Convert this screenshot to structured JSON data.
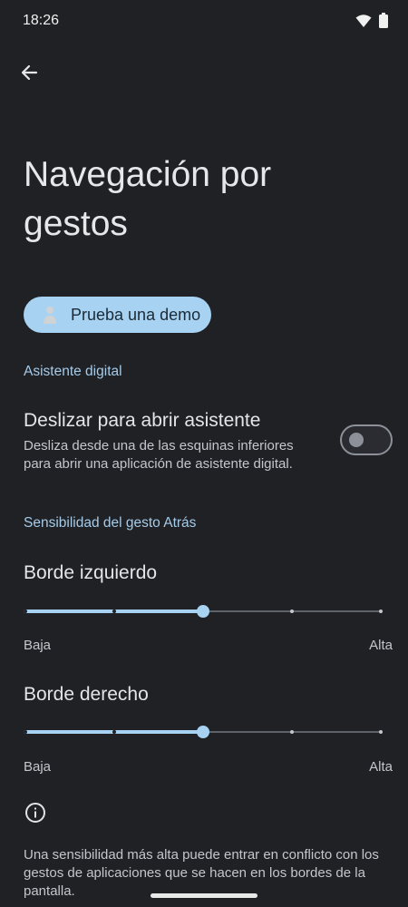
{
  "status_bar": {
    "time": "18:26",
    "icons": [
      "wifi-icon",
      "battery-icon"
    ]
  },
  "header": {
    "back_icon": "arrow-back-icon",
    "title": "Navegación por gestos"
  },
  "demo": {
    "label": "Prueba una demo",
    "icon": "person-figure-icon"
  },
  "assistant_section": {
    "header": "Asistente digital",
    "toggle_title": "Deslizar para abrir asistente",
    "toggle_summary": "Desliza desde una de las esquinas inferiores para abrir una aplicación de asistente digital.",
    "toggle_on": false
  },
  "sensitivity_section": {
    "header": "Sensibilidad del gesto Atrás",
    "sliders": [
      {
        "title": "Borde izquierdo",
        "min_label": "Baja",
        "max_label": "Alta",
        "value": 0.5,
        "steps": 5
      },
      {
        "title": "Borde derecho",
        "min_label": "Baja",
        "max_label": "Alta",
        "value": 0.5,
        "steps": 5
      }
    ]
  },
  "footer": {
    "info_icon": "info-icon",
    "text": "Una sensibilidad más alta puede entrar en conflicto con los gestos de aplicaciones que se hacen en los bordes de la pantalla."
  },
  "colors": {
    "background": "#1f2125",
    "accent": "#a8d2f2",
    "section_header": "#a6cbe9"
  }
}
